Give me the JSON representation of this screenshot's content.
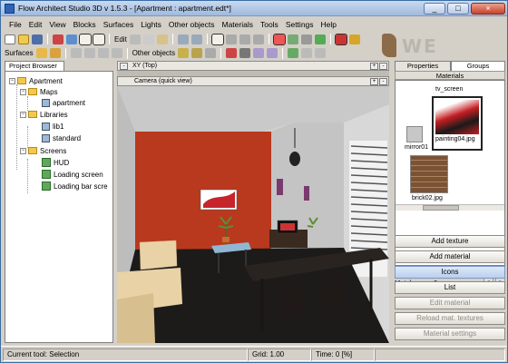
{
  "window": {
    "title": "Flow Architect Studio 3D v 1.5.3 - [Apartment : apartment.edt*]",
    "min": "_",
    "max": "□",
    "close": "×"
  },
  "menu": [
    "File",
    "Edit",
    "View",
    "Blocks",
    "Surfaces",
    "Lights",
    "Other objects",
    "Materials",
    "Tools",
    "Settings",
    "Help"
  ],
  "toolbar1": {
    "edit_label": "Edit"
  },
  "toolbar2": {
    "surfaces_label": "Surfaces",
    "other_objects_label": "Other objects"
  },
  "logo_text": "WE",
  "project_browser": {
    "tab": "Project Browser",
    "root": "Apartment",
    "maps": "Maps",
    "map_item": "apartment",
    "libraries": "Libraries",
    "lib1": "lib1",
    "lib2": "standard",
    "screens": "Screens",
    "screen_items": [
      "HUD",
      "Loading screen",
      "Loading bar scre"
    ]
  },
  "xy_panel": {
    "title": "XY (Top)",
    "btn_plus": "+",
    "btn_minus": "-"
  },
  "camera_panel": {
    "title": "Camera (quick view)",
    "btn_plus": "+",
    "btn_minus": "-"
  },
  "right_panel": {
    "tabs": [
      "Properties",
      "Groups"
    ],
    "header": "Materials",
    "materials": [
      "tv_screen",
      "mirror01",
      "painting04.jpg",
      "brick02.jpg"
    ],
    "mat_layer_label": "Mat. layer",
    "mat_layer_value": "0",
    "spin_prev": "<",
    "spin_next": ">",
    "buttons": [
      "Add texture",
      "Add material",
      "Icons",
      "List",
      "Edit material",
      "Reload mat. textures",
      "Material settings"
    ]
  },
  "status": {
    "tool": "Current tool:   Selection",
    "grid": "Grid: 1.00",
    "time": "Time: 0 [%]"
  },
  "colors": {
    "accent_wall": "#b8391e",
    "floor": "#1c1b1a",
    "sofa": "#e9d2a6"
  }
}
